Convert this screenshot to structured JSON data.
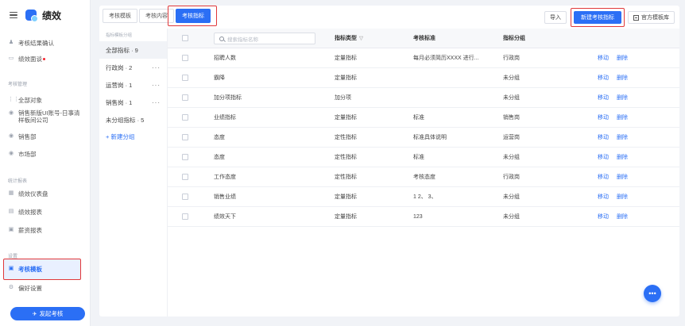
{
  "app": {
    "title": "绩效"
  },
  "sidebar": {
    "top_items": [
      {
        "label": "考核结果确认",
        "icon": "people-icon"
      },
      {
        "label": "绩效面谈",
        "icon": "chat-icon",
        "dot": true
      }
    ],
    "sections": [
      {
        "title": "考核管理"
      },
      {
        "title": "统计报表"
      },
      {
        "title": "设置"
      }
    ],
    "manage_items": [
      {
        "label": "全部对象",
        "icon": "grid-icon"
      },
      {
        "label": "销售新版UI账号-日事清样板间公司",
        "icon": "circle-icon"
      },
      {
        "label": "销售部",
        "icon": "circle-icon"
      },
      {
        "label": "市场部",
        "icon": "circle-icon"
      }
    ],
    "report_items": [
      {
        "label": "绩效仪表盘",
        "icon": "dashboard-icon"
      },
      {
        "label": "绩效报表",
        "icon": "report-icon"
      },
      {
        "label": "薪资报表",
        "icon": "salary-icon"
      }
    ],
    "settings_items": [
      {
        "label": "考核模板",
        "icon": "template-icon",
        "active": true
      },
      {
        "label": "偏好设置",
        "icon": "settings-icon"
      }
    ],
    "launch_button": "发起考核"
  },
  "tabs": [
    {
      "label": "考核模板"
    },
    {
      "label": "考核内容"
    },
    {
      "label": "考核指标",
      "active": true
    }
  ],
  "actions": {
    "import": "导入",
    "new_indicator": "新建考核指标",
    "official_library": "官方模板库"
  },
  "groups": {
    "header": "指标模板分组",
    "items": [
      {
        "label": "全部指标 · 9",
        "active": true
      },
      {
        "label": "行政岗 · 2",
        "more": "···"
      },
      {
        "label": "运营岗 · 1",
        "more": "···"
      },
      {
        "label": "销售岗 · 1",
        "more": "···"
      },
      {
        "label": "未分组指标 · 5"
      }
    ],
    "add_label": "+ 新建分组"
  },
  "table": {
    "search_placeholder": "搜索指标名称",
    "columns": {
      "type": "指标类型",
      "standard": "考核标准",
      "group": "指标分组"
    },
    "op_move": "移动",
    "op_delete": "删除",
    "rows": [
      {
        "name": "招聘人数",
        "type": "定量指标",
        "standard": "每月必须简历XXXX 进行...",
        "group": "行政岗"
      },
      {
        "name": "霸降",
        "type": "定量指标",
        "standard": "",
        "group": "未分组"
      },
      {
        "name": "加分项指标",
        "type": "加分项",
        "standard": "",
        "group": "未分组"
      },
      {
        "name": "业绩指标",
        "type": "定量指标",
        "standard": "标准",
        "group": "销售岗"
      },
      {
        "name": "态度",
        "type": "定性指标",
        "standard": "标准具体说明",
        "group": "运营岗"
      },
      {
        "name": "态度",
        "type": "定性指标",
        "standard": "标准",
        "group": "未分组"
      },
      {
        "name": "工作态度",
        "type": "定性指标",
        "standard": "考核态度",
        "group": "行政岗"
      },
      {
        "name": "销售业绩",
        "type": "定量指标",
        "standard": "1 2、 3、",
        "group": "未分组"
      },
      {
        "name": "绩效天下",
        "type": "定量指标",
        "standard": "123",
        "group": "未分组"
      }
    ]
  },
  "fab_label": "•••",
  "colors": {
    "accent": "#2b6ff5",
    "highlight": "#e0383a"
  }
}
